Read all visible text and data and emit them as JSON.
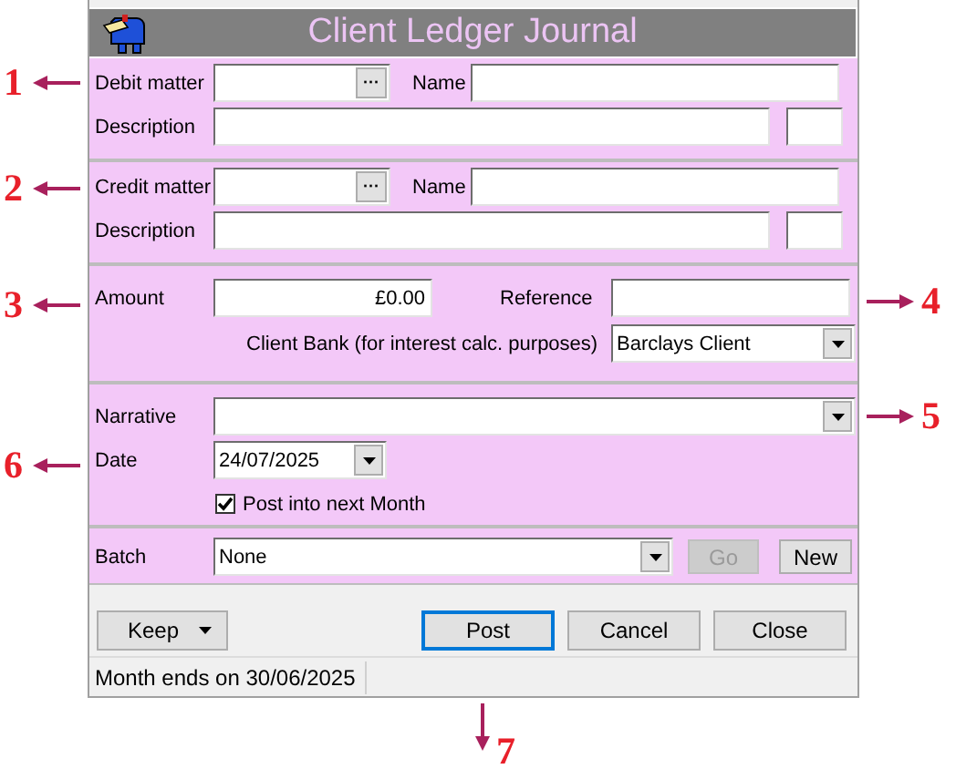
{
  "window": {
    "title": "Client Ledger Journal"
  },
  "debit": {
    "matter_label": "Debit matter",
    "lookup_button": "···",
    "name_label": "Name",
    "description_label": "Description"
  },
  "credit": {
    "matter_label": "Credit matter",
    "lookup_button": "···",
    "name_label": "Name",
    "description_label": "Description"
  },
  "amount": {
    "label": "Amount",
    "value": "£0.00"
  },
  "reference": {
    "label": "Reference"
  },
  "client_bank": {
    "label": "Client Bank (for interest calc. purposes)",
    "value": "Barclays Client"
  },
  "narrative": {
    "label": "Narrative"
  },
  "date": {
    "label": "Date",
    "value": "24/07/2025"
  },
  "post_next_month": {
    "label": "Post into next Month",
    "checked": true
  },
  "batch": {
    "label": "Batch",
    "value": "None",
    "buttons": [
      {
        "label": "Go",
        "disabled": true
      },
      {
        "label": "New",
        "disabled": false
      }
    ]
  },
  "buttons": [
    {
      "label": "Keep",
      "kind": "menu",
      "default": false
    },
    {
      "label": "Post",
      "kind": "plain",
      "default": true
    },
    {
      "label": "Cancel",
      "kind": "plain",
      "default": false
    },
    {
      "label": "Close",
      "kind": "plain",
      "default": false
    }
  ],
  "status_bar": {
    "text": "Month ends on 30/06/2025"
  },
  "callouts": [
    {
      "number": "1"
    },
    {
      "number": "2"
    },
    {
      "number": "3"
    },
    {
      "number": "4"
    },
    {
      "number": "5"
    },
    {
      "number": "6"
    },
    {
      "number": "7"
    }
  ]
}
